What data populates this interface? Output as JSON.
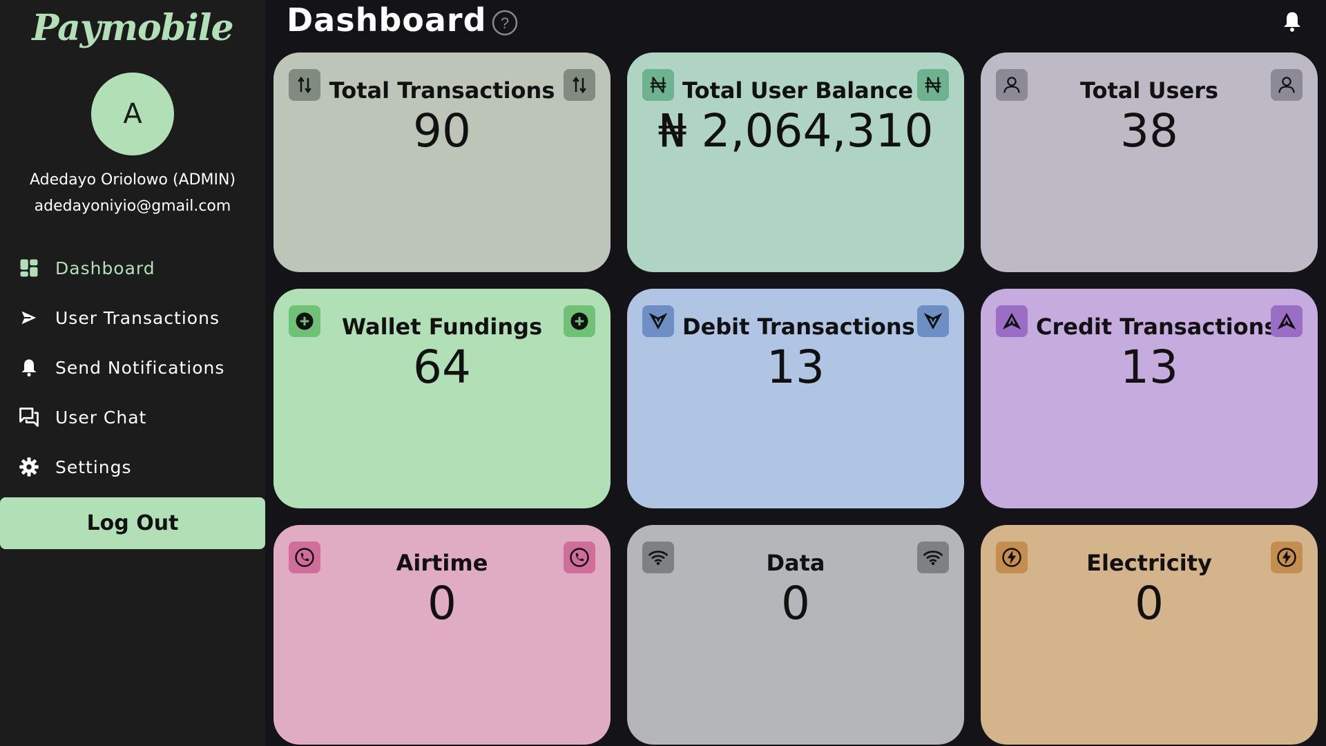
{
  "app": {
    "logo": "Paymobile"
  },
  "user": {
    "avatar_initial": "A",
    "name": "Adedayo Oriolowo (ADMIN)",
    "email": "adedayoniyio@gmail.com"
  },
  "nav": [
    {
      "label": "Dashboard",
      "icon": "dashboard-icon",
      "active": true
    },
    {
      "label": "User Transactions",
      "icon": "send-icon"
    },
    {
      "label": "Send Notifications",
      "icon": "bell-icon"
    },
    {
      "label": "User Chat",
      "icon": "chat-icon"
    },
    {
      "label": "Settings",
      "icon": "gear-icon"
    }
  ],
  "logout_label": "Log Out",
  "header": {
    "title": "Dashboard",
    "help_icon": "help-icon",
    "notification_icon": "bell-icon"
  },
  "cards": [
    {
      "title": "Total Transactions",
      "value": "90",
      "icon": "swap-arrows-icon",
      "bg": "#bcc5b8",
      "icon_bg": "#808c80"
    },
    {
      "title": "Total User Balance",
      "value": "₦ 2,064,310",
      "icon": "naira-icon",
      "bg": "#afd4c3",
      "icon_bg": "#6eb38f"
    },
    {
      "title": "Total Users",
      "value": "38",
      "icon": "user-icon",
      "bg": "#bdbac6",
      "icon_bg": "#8c8a96"
    },
    {
      "title": "Wallet Fundings",
      "value": "64",
      "icon": "plus-circle-icon",
      "bg": "#b2e0b6",
      "icon_bg": "#6fc275"
    },
    {
      "title": "Debit Transactions",
      "value": "13",
      "icon": "debit-icon",
      "bg": "#afc5e3",
      "icon_bg": "#6e8fc4"
    },
    {
      "title": "Credit Transactions",
      "value": "13",
      "icon": "credit-icon",
      "bg": "#c6acde",
      "icon_bg": "#9a6ec4"
    },
    {
      "title": "Airtime",
      "value": "0",
      "icon": "phone-icon",
      "bg": "#e0acc4",
      "icon_bg": "#cf6e9a"
    },
    {
      "title": "Data",
      "value": "0",
      "icon": "wifi-icon",
      "bg": "#b5b6ba",
      "icon_bg": "#7f8084"
    },
    {
      "title": "Electricity",
      "value": "0",
      "icon": "lightning-icon",
      "bg": "#d3b48b",
      "icon_bg": "#c48f4e"
    }
  ]
}
